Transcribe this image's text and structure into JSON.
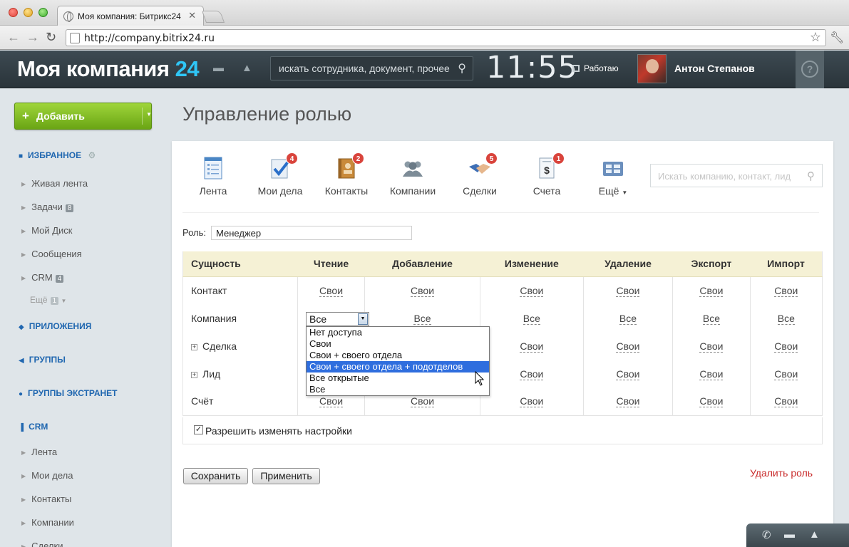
{
  "browser": {
    "tab_title": "Моя компания: Битрикс24",
    "url": "http://company.bitrix24.ru"
  },
  "header": {
    "logo_text": "Моя компания",
    "logo_num": "24",
    "search_placeholder": "искать сотрудника, документ, прочее",
    "clock": "11:55",
    "status": "Работаю",
    "user_name": "Антон Степанов",
    "help": "?"
  },
  "sidebar": {
    "add_button": "Добавить",
    "favorites_title": "ИЗБРАННОЕ",
    "favorites": [
      {
        "label": "Живая лента"
      },
      {
        "label": "Задачи",
        "badge": "8"
      },
      {
        "label": "Мой Диск"
      },
      {
        "label": "Сообщения"
      },
      {
        "label": "CRM",
        "badge": "4"
      }
    ],
    "more_label": "Ещё",
    "more_badge": "1",
    "apps_title": "ПРИЛОЖЕНИЯ",
    "groups_title": "ГРУППЫ",
    "extranet_title": "ГРУППЫ ЭКСТРАНЕТ",
    "crm_title": "CRM",
    "crm_items": [
      "Лента",
      "Мои дела",
      "Контакты",
      "Компании",
      "Сделки"
    ]
  },
  "page": {
    "title": "Управление ролью",
    "crm_search_placeholder": "Искать компанию, контакт, лид",
    "toolbar": [
      {
        "label": "Лента",
        "icon": "feed-icon"
      },
      {
        "label": "Мои дела",
        "icon": "tasks-icon",
        "badge": "4"
      },
      {
        "label": "Контакты",
        "icon": "contacts-icon",
        "badge": "2"
      },
      {
        "label": "Компании",
        "icon": "companies-icon"
      },
      {
        "label": "Сделки",
        "icon": "deals-icon",
        "badge": "5"
      },
      {
        "label": "Счета",
        "icon": "invoices-icon",
        "badge": "1"
      },
      {
        "label": "Ещё",
        "icon": "more-icon"
      }
    ],
    "role_label": "Роль:",
    "role_value": "Менеджер",
    "table": {
      "headers": [
        "Сущность",
        "Чтение",
        "Добавление",
        "Изменение",
        "Удаление",
        "Экспорт",
        "Импорт"
      ],
      "rows": [
        {
          "entity": "Контакт",
          "values": [
            "Свои",
            "Свои",
            "Свои",
            "Свои",
            "Свои",
            "Свои"
          ]
        },
        {
          "entity": "Компания",
          "values": [
            "Все",
            "Все",
            "Все",
            "Все",
            "Все",
            "Все"
          ]
        },
        {
          "entity": "Сделка",
          "values": [
            "",
            "",
            "Свои",
            "Свои",
            "Свои",
            "Свои"
          ]
        },
        {
          "entity": "Лид",
          "values": [
            "",
            "",
            "Свои",
            "Свои",
            "Свои",
            "Свои"
          ]
        },
        {
          "entity": "Счёт",
          "values": [
            "Свои",
            "Свои",
            "Свои",
            "Свои",
            "Свои",
            "Свои"
          ]
        }
      ]
    },
    "select_value": "Все",
    "dropdown_options": [
      "Нет доступа",
      "Свои",
      "Свои + своего отдела",
      "Свои + своего отдела + подотделов",
      "Все открытые",
      "Все"
    ],
    "dropdown_highlighted_index": 3,
    "allow_label": "Разрешить изменять настройки",
    "save_button": "Сохранить",
    "apply_button": "Применить",
    "delete_role": "Удалить роль"
  }
}
